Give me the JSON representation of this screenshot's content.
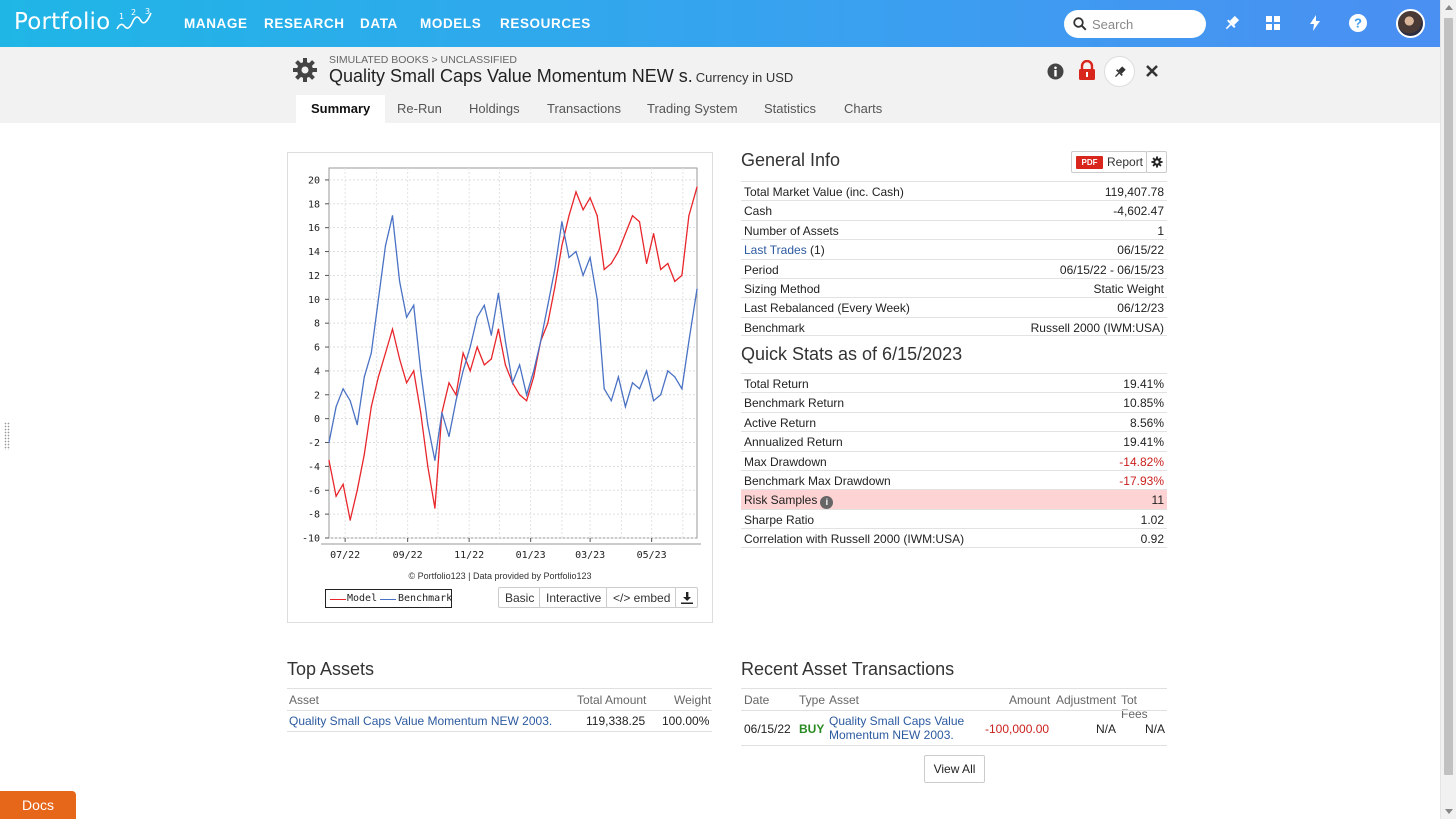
{
  "nav": {
    "logo_text": "Portfolio",
    "items": [
      "MANAGE",
      "RESEARCH",
      "DATA",
      "MODELS",
      "RESOURCES"
    ],
    "search_placeholder": "Search"
  },
  "header": {
    "breadcrumb": "SIMULATED BOOKS > UNCLASSIFIED",
    "title": "Quality Small Caps Value Momentum NEW s.",
    "currency": "Currency in USD"
  },
  "tabs": [
    "Summary",
    "Re-Run",
    "Holdings",
    "Transactions",
    "Trading System",
    "Statistics",
    "Charts"
  ],
  "chart": {
    "copyright": "© Portfolio123 | Data provided by Portfolio123",
    "legend": {
      "model": "Model",
      "benchmark": "Benchmark"
    },
    "buttons": {
      "basic": "Basic",
      "interactive": "Interactive",
      "embed": "</> embed"
    }
  },
  "chart_data": {
    "type": "line",
    "title": "",
    "xlabel": "",
    "ylabel": "",
    "ylim": [
      -10,
      21
    ],
    "yticks": [
      20,
      18,
      16,
      14,
      12,
      10,
      8,
      6,
      4,
      2,
      0,
      -2,
      -4,
      -6,
      -8,
      -10
    ],
    "xticks": [
      "07/22",
      "09/22",
      "11/22",
      "01/23",
      "03/23",
      "05/23"
    ],
    "x_range": [
      "06/15/22",
      "06/15/23"
    ],
    "grid": true,
    "series": [
      {
        "name": "Model",
        "color": "#e8262b",
        "points": [
          [
            "06/15/22",
            -3.5
          ],
          [
            "06/22/22",
            -6.5
          ],
          [
            "06/29/22",
            -5.5
          ],
          [
            "07/06/22",
            -8.5
          ],
          [
            "07/13/22",
            -6.0
          ],
          [
            "07/20/22",
            -3.0
          ],
          [
            "07/27/22",
            1.0
          ],
          [
            "08/03/22",
            3.5
          ],
          [
            "08/10/22",
            5.5
          ],
          [
            "08/17/22",
            7.5
          ],
          [
            "08/24/22",
            5.0
          ],
          [
            "08/31/22",
            3.0
          ],
          [
            "09/07/22",
            4.0
          ],
          [
            "09/14/22",
            0.5
          ],
          [
            "09/21/22",
            -4.0
          ],
          [
            "09/28/22",
            -7.5
          ],
          [
            "10/05/22",
            0.5
          ],
          [
            "10/12/22",
            3.0
          ],
          [
            "10/19/22",
            2.0
          ],
          [
            "10/26/22",
            5.5
          ],
          [
            "11/02/22",
            4.0
          ],
          [
            "11/09/22",
            6.0
          ],
          [
            "11/16/22",
            4.5
          ],
          [
            "11/23/22",
            5.0
          ],
          [
            "11/30/22",
            7.5
          ],
          [
            "12/07/22",
            4.5
          ],
          [
            "12/14/22",
            3.0
          ],
          [
            "12/21/22",
            2.0
          ],
          [
            "12/28/22",
            1.5
          ],
          [
            "01/04/23",
            3.5
          ],
          [
            "01/11/23",
            6.5
          ],
          [
            "01/18/23",
            8.0
          ],
          [
            "01/25/23",
            11.0
          ],
          [
            "02/01/23",
            14.5
          ],
          [
            "02/08/23",
            17.0
          ],
          [
            "02/15/23",
            19.0
          ],
          [
            "02/22/23",
            17.5
          ],
          [
            "03/01/23",
            18.5
          ],
          [
            "03/08/23",
            17.0
          ],
          [
            "03/15/23",
            12.5
          ],
          [
            "03/22/23",
            13.0
          ],
          [
            "03/29/23",
            14.0
          ],
          [
            "04/05/23",
            15.5
          ],
          [
            "04/12/23",
            17.0
          ],
          [
            "04/19/23",
            16.5
          ],
          [
            "04/26/23",
            13.0
          ],
          [
            "05/03/23",
            15.5
          ],
          [
            "05/10/23",
            12.5
          ],
          [
            "05/17/23",
            13.0
          ],
          [
            "05/24/23",
            11.5
          ],
          [
            "05/31/23",
            12.0
          ],
          [
            "06/07/23",
            17.0
          ],
          [
            "06/15/23",
            19.4
          ]
        ]
      },
      {
        "name": "Benchmark",
        "color": "#4a72c4",
        "points": [
          [
            "06/15/22",
            -2.0
          ],
          [
            "06/22/22",
            1.0
          ],
          [
            "06/29/22",
            2.5
          ],
          [
            "07/06/22",
            1.5
          ],
          [
            "07/13/22",
            -0.5
          ],
          [
            "07/20/22",
            3.5
          ],
          [
            "07/27/22",
            5.5
          ],
          [
            "08/03/22",
            10.0
          ],
          [
            "08/10/22",
            14.5
          ],
          [
            "08/17/22",
            17.0
          ],
          [
            "08/24/22",
            11.5
          ],
          [
            "08/31/22",
            8.5
          ],
          [
            "09/07/22",
            9.5
          ],
          [
            "09/14/22",
            4.0
          ],
          [
            "09/21/22",
            -0.5
          ],
          [
            "09/28/22",
            -3.5
          ],
          [
            "10/05/22",
            0.5
          ],
          [
            "10/12/22",
            -1.5
          ],
          [
            "10/19/22",
            1.5
          ],
          [
            "10/26/22",
            4.0
          ],
          [
            "11/02/22",
            6.0
          ],
          [
            "11/09/22",
            8.5
          ],
          [
            "11/16/22",
            9.5
          ],
          [
            "11/23/22",
            7.0
          ],
          [
            "11/30/22",
            10.5
          ],
          [
            "12/07/22",
            6.5
          ],
          [
            "12/14/22",
            3.0
          ],
          [
            "12/21/22",
            4.5
          ],
          [
            "12/28/22",
            2.0
          ],
          [
            "01/04/23",
            4.0
          ],
          [
            "01/11/23",
            6.5
          ],
          [
            "01/18/23",
            9.5
          ],
          [
            "01/25/23",
            12.5
          ],
          [
            "02/01/23",
            16.5
          ],
          [
            "02/08/23",
            13.5
          ],
          [
            "02/15/23",
            14.0
          ],
          [
            "02/22/23",
            12.0
          ],
          [
            "03/01/23",
            13.5
          ],
          [
            "03/08/23",
            10.0
          ],
          [
            "03/15/23",
            2.5
          ],
          [
            "03/22/23",
            1.5
          ],
          [
            "03/29/23",
            3.5
          ],
          [
            "04/05/23",
            1.0
          ],
          [
            "04/12/23",
            3.0
          ],
          [
            "04/19/23",
            2.5
          ],
          [
            "04/26/23",
            4.0
          ],
          [
            "05/03/23",
            1.5
          ],
          [
            "05/10/23",
            2.0
          ],
          [
            "05/17/23",
            4.0
          ],
          [
            "05/24/23",
            3.5
          ],
          [
            "05/31/23",
            2.5
          ],
          [
            "06/07/23",
            6.5
          ],
          [
            "06/15/23",
            10.85
          ]
        ]
      }
    ]
  },
  "general_info": {
    "title": "General Info",
    "report_label": "Report",
    "pdf_label": "PDF",
    "rows": [
      {
        "k": "Total Market Value (inc. Cash)",
        "v": "119,407.78"
      },
      {
        "k": "Cash",
        "v": "-4,602.47"
      },
      {
        "k": "Number of Assets",
        "v": "1"
      },
      {
        "k": "Last Trades",
        "k2": "(1)",
        "v": "06/15/22"
      },
      {
        "k": "Period",
        "v": "06/15/22 - 06/15/23"
      },
      {
        "k": "Sizing Method",
        "v": "Static Weight"
      },
      {
        "k": "Last Rebalanced (Every Week)",
        "v": "06/12/23"
      },
      {
        "k": "Benchmark",
        "v": "Russell 2000 (IWM:USA)"
      }
    ]
  },
  "quick_stats": {
    "title": "Quick Stats as of 6/15/2023",
    "rows": [
      {
        "k": "Total Return",
        "v": "19.41%"
      },
      {
        "k": "Benchmark Return",
        "v": "10.85%"
      },
      {
        "k": "Active Return",
        "v": "8.56%"
      },
      {
        "k": "Annualized Return",
        "v": "19.41%"
      },
      {
        "k": "Max Drawdown",
        "v": "-14.82%"
      },
      {
        "k": "Benchmark Max Drawdown",
        "v": "-17.93%"
      },
      {
        "k": "Risk Samples",
        "v": "11"
      },
      {
        "k": "Sharpe Ratio",
        "v": "1.02"
      },
      {
        "k": "Correlation with Russell 2000 (IWM:USA)",
        "v": "0.92"
      }
    ]
  },
  "top_assets": {
    "title": "Top Assets",
    "headers": {
      "asset": "Asset",
      "amount": "Total Amount",
      "weight": "Weight"
    },
    "rows": [
      {
        "asset": "Quality Small Caps Value Momentum NEW 2003.",
        "amount": "119,338.25",
        "weight": "100.00%"
      }
    ]
  },
  "recent_tx": {
    "title": "Recent Asset Transactions",
    "headers": {
      "date": "Date",
      "type": "Type",
      "asset": "Asset",
      "amount": "Amount",
      "adjustment": "Adjustment",
      "fees": "Tot Fees"
    },
    "rows": [
      {
        "date": "06/15/22",
        "type": "BUY",
        "asset_line1": "Quality Small Caps Value",
        "asset_line2": "Momentum NEW 2003.",
        "amount": "-100,000.00",
        "adjustment": "N/A",
        "fees": "N/A"
      }
    ],
    "view_all": "View All"
  },
  "docs_label": "Docs"
}
